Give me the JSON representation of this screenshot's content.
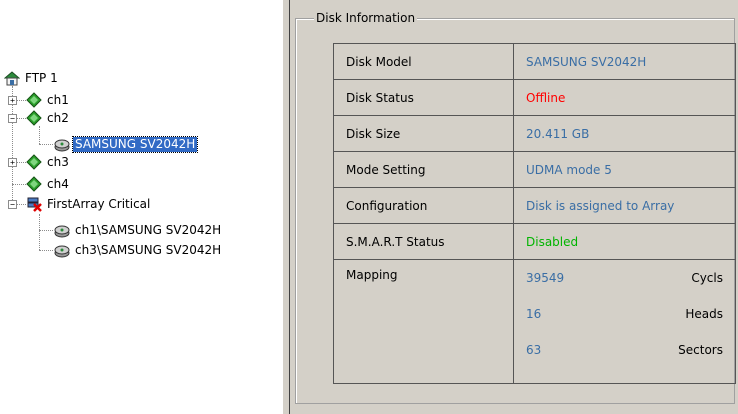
{
  "tree": {
    "root": {
      "label": "FTP 1",
      "icon": "server-house-icon"
    },
    "nodes": [
      {
        "label": "ch1",
        "expander": "+",
        "icon": "channel-diamond-icon"
      },
      {
        "label": "ch2",
        "expander": "−",
        "icon": "channel-diamond-icon"
      },
      {
        "label": "SAMSUNG SV2042H",
        "icon": "disk-drive-icon",
        "selected": true
      },
      {
        "label": "ch3",
        "expander": "+",
        "icon": "channel-diamond-icon"
      },
      {
        "label": "ch4",
        "icon": "channel-diamond-icon"
      },
      {
        "label": "FirstArray Critical",
        "expander": "−",
        "icon": "array-critical-icon"
      },
      {
        "label": "ch1\\SAMSUNG SV2042H",
        "icon": "disk-drive-icon"
      },
      {
        "label": "ch3\\SAMSUNG SV2042H",
        "icon": "disk-drive-icon"
      }
    ]
  },
  "panel": {
    "group_title": "Disk Information",
    "rows": [
      {
        "key": "Disk Model",
        "value": "SAMSUNG SV2042H",
        "color": "#3a6ea5"
      },
      {
        "key": "Disk Status",
        "value": "Offline",
        "color": "#ff0000"
      },
      {
        "key": "Disk Size",
        "value": "20.411 GB",
        "color": "#3a6ea5"
      },
      {
        "key": "Mode Setting",
        "value": "UDMA mode 5",
        "color": "#3a6ea5"
      },
      {
        "key": "Configuration",
        "value": "Disk is assigned to Array",
        "color": "#3a6ea5"
      },
      {
        "key": "S.M.A.R.T Status",
        "value": "Disabled",
        "color": "#00b400"
      }
    ],
    "mapping": {
      "key": "Mapping",
      "entries": [
        {
          "value": "39549",
          "unit": "Cycls"
        },
        {
          "value": "16",
          "unit": "Heads"
        },
        {
          "value": "63",
          "unit": "Sectors"
        }
      ]
    }
  },
  "colors": {
    "selection": "#316ac5",
    "panel_bg": "#d4d0c8",
    "value_blue": "#3a6ea5",
    "status_red": "#ff0000",
    "status_green": "#00b400"
  }
}
